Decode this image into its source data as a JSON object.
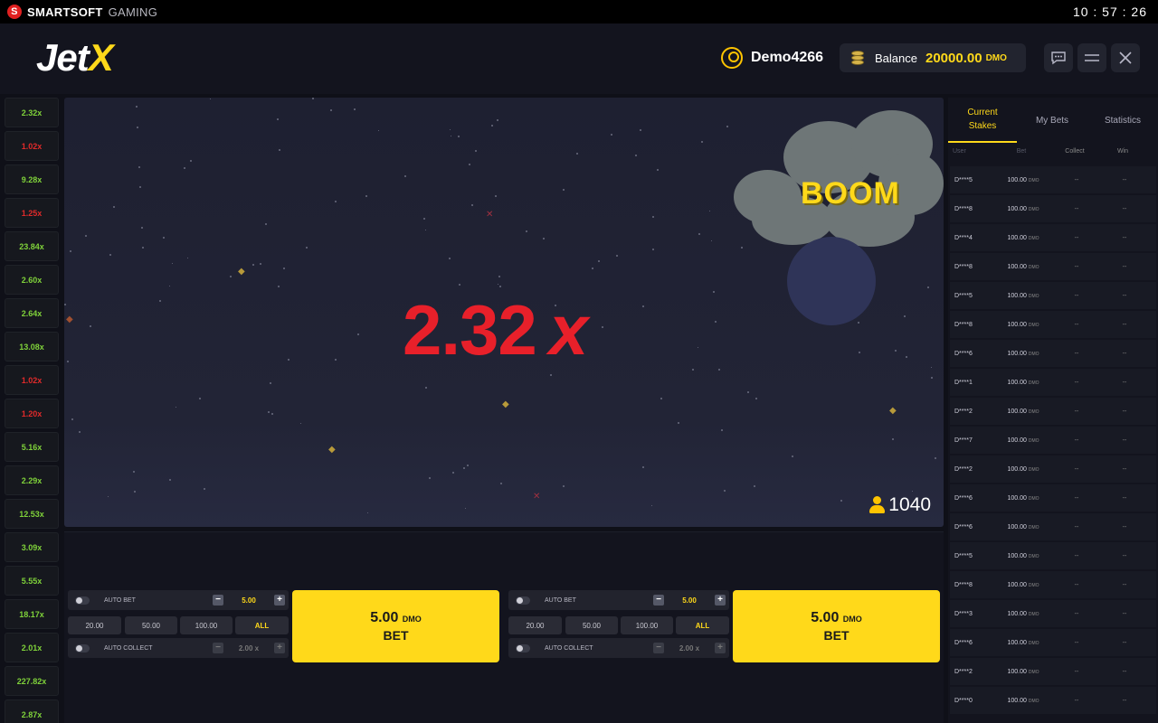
{
  "topbar": {
    "brand_bold": "SMARTSOFT",
    "brand_light": "GAMING",
    "clock": "10 : 57 : 26"
  },
  "header": {
    "logo_jet": "Jet",
    "logo_x": "X",
    "username": "Demo4266",
    "balance_label": "Balance",
    "balance_value": "20000.00",
    "balance_unit": "DMO"
  },
  "history": [
    {
      "value": "2.32x",
      "color": "green"
    },
    {
      "value": "1.02x",
      "color": "red"
    },
    {
      "value": "9.28x",
      "color": "green"
    },
    {
      "value": "1.25x",
      "color": "red"
    },
    {
      "value": "23.84x",
      "color": "green"
    },
    {
      "value": "2.60x",
      "color": "green"
    },
    {
      "value": "2.64x",
      "color": "green"
    },
    {
      "value": "13.08x",
      "color": "green"
    },
    {
      "value": "1.02x",
      "color": "red"
    },
    {
      "value": "1.20x",
      "color": "red"
    },
    {
      "value": "5.16x",
      "color": "green"
    },
    {
      "value": "2.29x",
      "color": "green"
    },
    {
      "value": "12.53x",
      "color": "green"
    },
    {
      "value": "3.09x",
      "color": "green"
    },
    {
      "value": "5.55x",
      "color": "green"
    },
    {
      "value": "18.17x",
      "color": "green"
    },
    {
      "value": "2.01x",
      "color": "green"
    },
    {
      "value": "227.82x",
      "color": "green"
    },
    {
      "value": "2.87x",
      "color": "green"
    }
  ],
  "game": {
    "multiplier_value": "2.32",
    "multiplier_x": "x",
    "boom_text": "BOOM",
    "players_count": "1040"
  },
  "bet_panels": [
    {
      "auto_bet_label": "AUTO BET",
      "amount": "5.00",
      "quick": [
        "20.00",
        "50.00",
        "100.00",
        "ALL"
      ],
      "auto_collect_label": "AUTO COLLECT",
      "collect_value": "2.00",
      "collect_x": "x",
      "button_amount": "5.00",
      "button_unit": "DMO",
      "button_label": "BET"
    },
    {
      "auto_bet_label": "AUTO BET",
      "amount": "5.00",
      "quick": [
        "20.00",
        "50.00",
        "100.00",
        "ALL"
      ],
      "auto_collect_label": "AUTO COLLECT",
      "collect_value": "2.00",
      "collect_x": "x",
      "button_amount": "5.00",
      "button_unit": "DMO",
      "button_label": "BET"
    }
  ],
  "sidebar": {
    "tabs": [
      "Current Stakes",
      "My Bets",
      "Statistics"
    ],
    "columns": [
      "User",
      "Bet",
      "Collect",
      "Win"
    ],
    "bet_unit": "DMO",
    "rows": [
      {
        "user": "D****5",
        "bet": "100.00",
        "collect": "--",
        "win": "--"
      },
      {
        "user": "D****8",
        "bet": "100.00",
        "collect": "--",
        "win": "--"
      },
      {
        "user": "D****4",
        "bet": "100.00",
        "collect": "--",
        "win": "--"
      },
      {
        "user": "D****8",
        "bet": "100.00",
        "collect": "--",
        "win": "--"
      },
      {
        "user": "D****5",
        "bet": "100.00",
        "collect": "--",
        "win": "--"
      },
      {
        "user": "D****8",
        "bet": "100.00",
        "collect": "--",
        "win": "--"
      },
      {
        "user": "D****6",
        "bet": "100.00",
        "collect": "--",
        "win": "--"
      },
      {
        "user": "D****1",
        "bet": "100.00",
        "collect": "--",
        "win": "--"
      },
      {
        "user": "D****2",
        "bet": "100.00",
        "collect": "--",
        "win": "--"
      },
      {
        "user": "D****7",
        "bet": "100.00",
        "collect": "--",
        "win": "--"
      },
      {
        "user": "D****2",
        "bet": "100.00",
        "collect": "--",
        "win": "--"
      },
      {
        "user": "D****6",
        "bet": "100.00",
        "collect": "--",
        "win": "--"
      },
      {
        "user": "D****6",
        "bet": "100.00",
        "collect": "--",
        "win": "--"
      },
      {
        "user": "D****5",
        "bet": "100.00",
        "collect": "--",
        "win": "--"
      },
      {
        "user": "D****8",
        "bet": "100.00",
        "collect": "--",
        "win": "--"
      },
      {
        "user": "D****3",
        "bet": "100.00",
        "collect": "--",
        "win": "--"
      },
      {
        "user": "D****6",
        "bet": "100.00",
        "collect": "--",
        "win": "--"
      },
      {
        "user": "D****2",
        "bet": "100.00",
        "collect": "--",
        "win": "--"
      },
      {
        "user": "D****0",
        "bet": "100.00",
        "collect": "--",
        "win": "--"
      }
    ]
  },
  "colors": {
    "accent": "#ffd91a",
    "crash_red": "#e8202a",
    "win_green": "#7fd23a"
  }
}
